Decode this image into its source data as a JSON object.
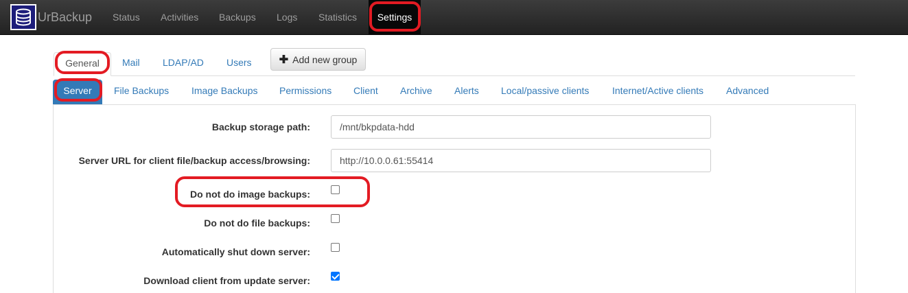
{
  "navbar": {
    "brand": "UrBackup",
    "items": [
      "Status",
      "Activities",
      "Backups",
      "Logs",
      "Statistics",
      "Settings"
    ],
    "active": "Settings"
  },
  "group_tabs": {
    "items": [
      "General",
      "Mail",
      "LDAP/AD",
      "Users"
    ],
    "active": "General",
    "add_button": "Add new group"
  },
  "sub_tabs": {
    "items": [
      "Server",
      "File Backups",
      "Image Backups",
      "Permissions",
      "Client",
      "Archive",
      "Alerts",
      "Local/passive clients",
      "Internet/Active clients",
      "Advanced"
    ],
    "active": "Server"
  },
  "settings": {
    "backup_storage_path": {
      "label": "Backup storage path:",
      "value": "/mnt/bkpdata-hdd"
    },
    "server_url": {
      "label": "Server URL for client file/backup access/browsing:",
      "value": "http://10.0.0.61:55414"
    },
    "no_image_backups": {
      "label": "Do not do image backups:",
      "checked": false
    },
    "no_file_backups": {
      "label": "Do not do file backups:",
      "checked": false
    },
    "auto_shutdown": {
      "label": "Automatically shut down server:",
      "checked": false
    },
    "download_client_update": {
      "label": "Download client from update server:",
      "checked": true
    }
  },
  "colors": {
    "highlight": "#e31b23",
    "link": "#337ab7",
    "navbar": "#222222"
  }
}
